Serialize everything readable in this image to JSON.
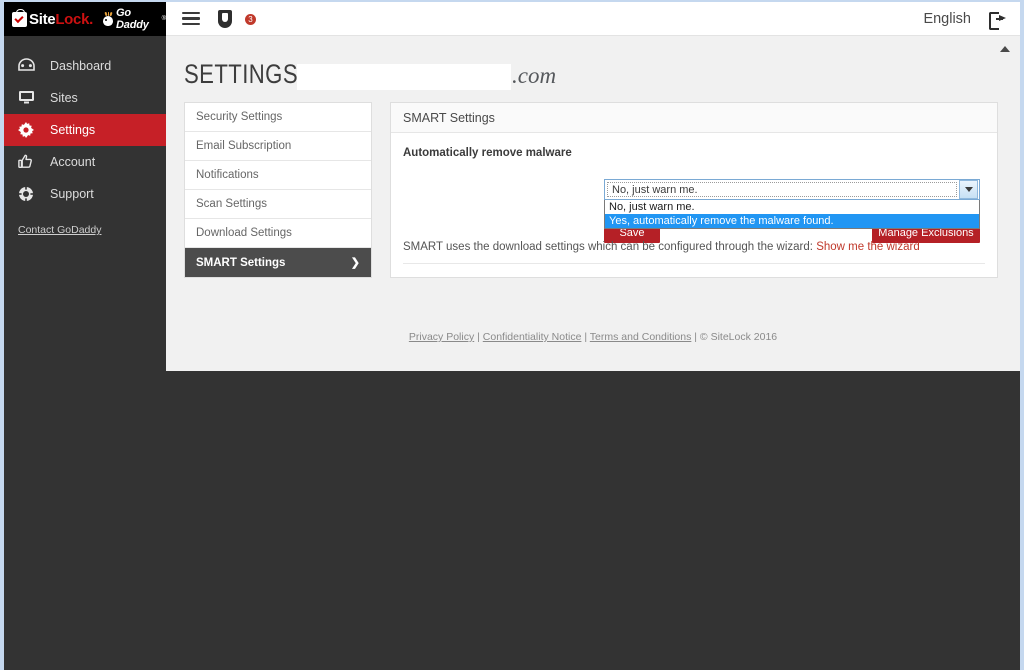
{
  "brand": {
    "site_text": "Site",
    "lock_text": "Lock",
    "dot": ".",
    "godaddy_text": "Go Daddy",
    "godaddy_tm": "®"
  },
  "sidebar": {
    "items": [
      {
        "label": "Dashboard",
        "icon": "dashboard-icon",
        "active": false
      },
      {
        "label": "Sites",
        "icon": "monitor-icon",
        "active": false
      },
      {
        "label": "Settings",
        "icon": "gear-icon",
        "active": true
      },
      {
        "label": "Account",
        "icon": "thumbs-up-icon",
        "active": false
      },
      {
        "label": "Support",
        "icon": "life-ring-icon",
        "active": false
      }
    ],
    "contact_link": "Contact GoDaddy"
  },
  "topbar": {
    "hamburger_icon": "hamburger-icon",
    "shield_icon": "shield-icon",
    "mail_icon": "mail-icon",
    "mail_badge": "3",
    "language": "English",
    "logout_icon": "logout-icon",
    "scroll_up_icon": "chevron-up-icon"
  },
  "header": {
    "title": "SETTINGS",
    "domain_redacted": "",
    "domain_tld": ".com"
  },
  "settings_nav": {
    "items": [
      {
        "label": "Security Settings",
        "active": false
      },
      {
        "label": "Email Subscription",
        "active": false
      },
      {
        "label": "Notifications",
        "active": false
      },
      {
        "label": "Scan Settings",
        "active": false
      },
      {
        "label": "Download Settings",
        "active": false
      },
      {
        "label": "SMART Settings",
        "active": true
      }
    ],
    "active_chevron": "❯"
  },
  "panel": {
    "title": "SMART Settings",
    "field_label": "Automatically remove malware",
    "dropdown": {
      "selected": "No, just warn me.",
      "expanded": true,
      "options": [
        {
          "label": "No, just warn me.",
          "highlighted": false
        },
        {
          "label": "Yes, automatically remove the malware found.",
          "highlighted": true
        }
      ],
      "arrow_icon": "chevron-down-icon"
    },
    "save_label": "Save",
    "manage_label": "Manage Exclusions",
    "note_text": "SMART uses the download settings which can be configured through the wizard:",
    "note_link": "Show me the wizard"
  },
  "footer": {
    "privacy": "Privacy Policy",
    "sep1": " | ",
    "confidentiality": "Confidentiality Notice",
    "sep2": " | ",
    "terms": "Terms and Conditions",
    "sep3": " | ",
    "copyright": "© SiteLock 2016"
  },
  "colors": {
    "brand_red": "#c62027",
    "sidebar_dark": "#333333",
    "button_red": "#b52026",
    "highlight_blue": "#2196f3",
    "active_nav_gray": "#4c4c4c"
  }
}
